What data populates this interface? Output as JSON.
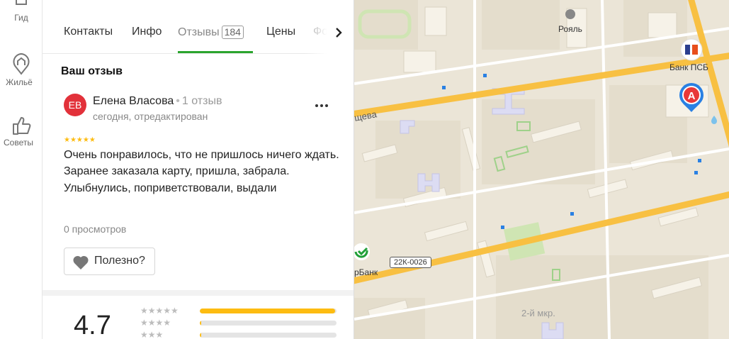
{
  "rail": {
    "items": [
      {
        "label": "Гид",
        "icon": "guide-icon"
      },
      {
        "label": "Жильё",
        "icon": "housing-icon"
      },
      {
        "label": "Советы",
        "icon": "thumbs-up-icon"
      }
    ]
  },
  "tabs": [
    {
      "label": "Контакты"
    },
    {
      "label": "Инфо"
    },
    {
      "label": "Отзывы",
      "count": "184",
      "active": true
    },
    {
      "label": "Цены"
    },
    {
      "label": "Фо"
    }
  ],
  "review_section": {
    "title": "Ваш отзыв",
    "author": "Елена Власова",
    "author_initials": "ЕВ",
    "author_review_count": "1 отзыв",
    "date": "сегодня, отредактирован",
    "stars": 5,
    "text": "Очень понравилось, что не пришлось ничего ждать. Заранее заказала карту, пришла, забрала. Улыбнулись, поприветствовали, выдали",
    "views": "0 просмотров",
    "useful_label": "Полезно?"
  },
  "rating_summary": {
    "rating": "4.7",
    "distribution": [
      {
        "stars": 5,
        "fraction": 0.99
      },
      {
        "stars": 4,
        "fraction": 0.01
      },
      {
        "stars": 3,
        "fraction": 0.01
      }
    ]
  },
  "map": {
    "labels": {
      "poi_royal": "Рояль",
      "poi_bank_psb": "Банк ПСБ",
      "street": "щева",
      "poi_sberbank": "рБанк",
      "route": "22К-0026",
      "district": "2-й мкр."
    },
    "colors": {
      "road": "#f8c042",
      "block": "#e6dfce",
      "building": "#f6f2e8",
      "park": "#cfe5b3",
      "accent": "#2980e3"
    }
  }
}
